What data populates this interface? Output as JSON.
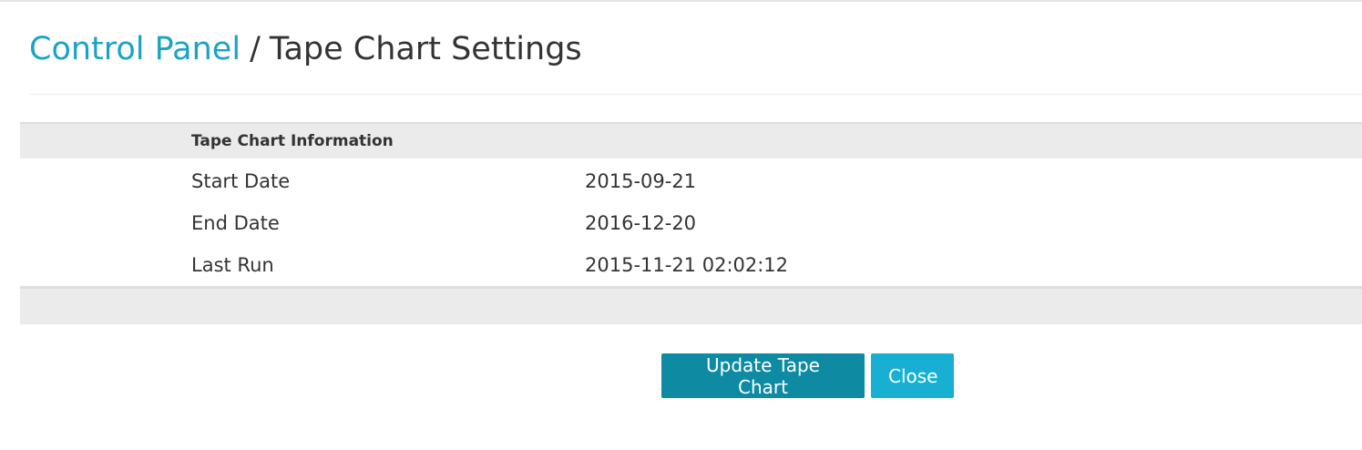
{
  "breadcrumb": {
    "parent": "Control Panel",
    "separator": "/",
    "current": "Tape Chart Settings"
  },
  "info": {
    "title": "Tape Chart Information",
    "rows": [
      {
        "label": "Start Date",
        "value": "2015-09-21"
      },
      {
        "label": "End Date",
        "value": "2016-12-20"
      },
      {
        "label": "Last Run",
        "value": "2015-11-21 02:02:12"
      }
    ]
  },
  "actions": {
    "update_label": "Update Tape Chart",
    "close_label": "Close"
  },
  "colors": {
    "link": "#1ba3c6",
    "primary_button": "#0e8aa3",
    "info_button": "#17b0d3",
    "panel_bg": "#ebebeb"
  }
}
